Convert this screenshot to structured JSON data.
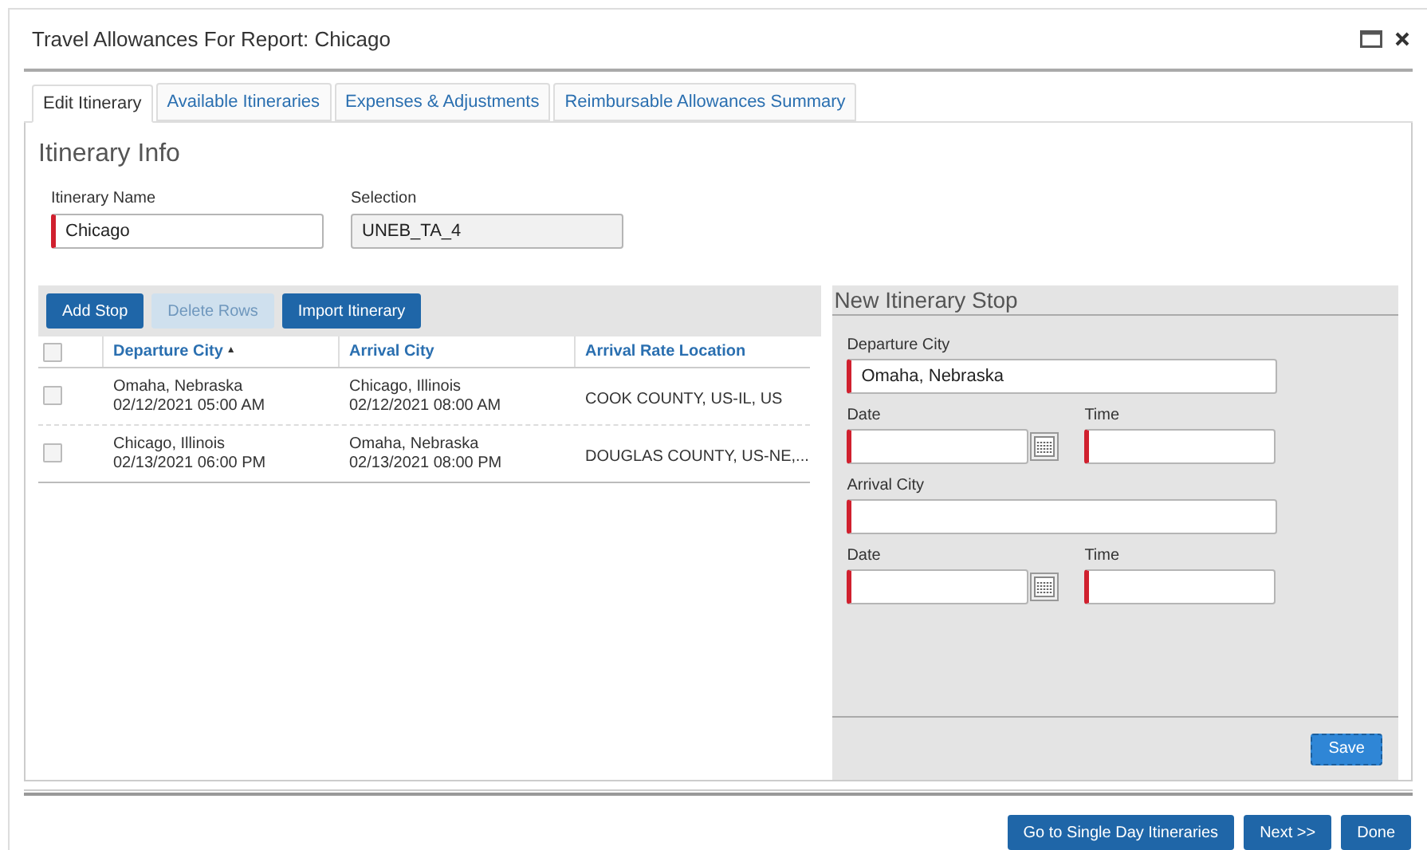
{
  "window": {
    "title": "Travel Allowances For Report: Chicago"
  },
  "tabs": [
    {
      "label": "Edit Itinerary",
      "selected": true
    },
    {
      "label": "Available Itineraries",
      "selected": false
    },
    {
      "label": "Expenses & Adjustments",
      "selected": false
    },
    {
      "label": "Reimbursable Allowances Summary",
      "selected": false
    }
  ],
  "itinerary_info": {
    "heading": "Itinerary Info",
    "fields": [
      {
        "label": "Itinerary Name",
        "value": "Chicago",
        "required": true,
        "disabled": false
      },
      {
        "label": "Selection",
        "value": "UNEB_TA_4",
        "required": false,
        "disabled": true
      }
    ]
  },
  "toolbar": [
    {
      "label": "Add Stop",
      "disabled": false
    },
    {
      "label": "Delete Rows",
      "disabled": true
    },
    {
      "label": "Import Itinerary",
      "disabled": false
    }
  ],
  "table": {
    "header_checked": false,
    "sort_mark": "▲",
    "columns": [
      "Departure City",
      "Arrival City",
      "Arrival Rate Location"
    ],
    "rows": [
      {
        "checked": false,
        "departure": [
          "Omaha, Nebraska",
          "02/12/2021 05:00 AM"
        ],
        "arrival": [
          "Chicago, Illinois",
          "02/12/2021 08:00 AM"
        ],
        "location": "COOK COUNTY, US-IL, US"
      },
      {
        "checked": false,
        "departure": [
          "Chicago, Illinois",
          "02/13/2021 06:00 PM"
        ],
        "arrival": [
          "Omaha, Nebraska",
          "02/13/2021 08:00 PM"
        ],
        "location": "DOUGLAS COUNTY, US-NE,..."
      }
    ]
  },
  "new_stop": {
    "heading": "New Itinerary Stop",
    "rows": [
      [
        {
          "kind": "text",
          "label": "Departure City",
          "value": "Omaha, Nebraska",
          "required": true
        }
      ],
      [
        {
          "kind": "date",
          "label": "Date",
          "required": true
        },
        {
          "kind": "text",
          "label": "Time",
          "required": true
        }
      ],
      [
        {
          "kind": "text",
          "label": "Arrival City",
          "required": true
        }
      ],
      [
        {
          "kind": "date",
          "label": "Date",
          "required": true
        },
        {
          "kind": "text",
          "label": "Time",
          "required": true
        }
      ]
    ],
    "save": "Save"
  },
  "footer_buttons": [
    "Go to Single Day Itineraries",
    "Next >>",
    "Done"
  ]
}
